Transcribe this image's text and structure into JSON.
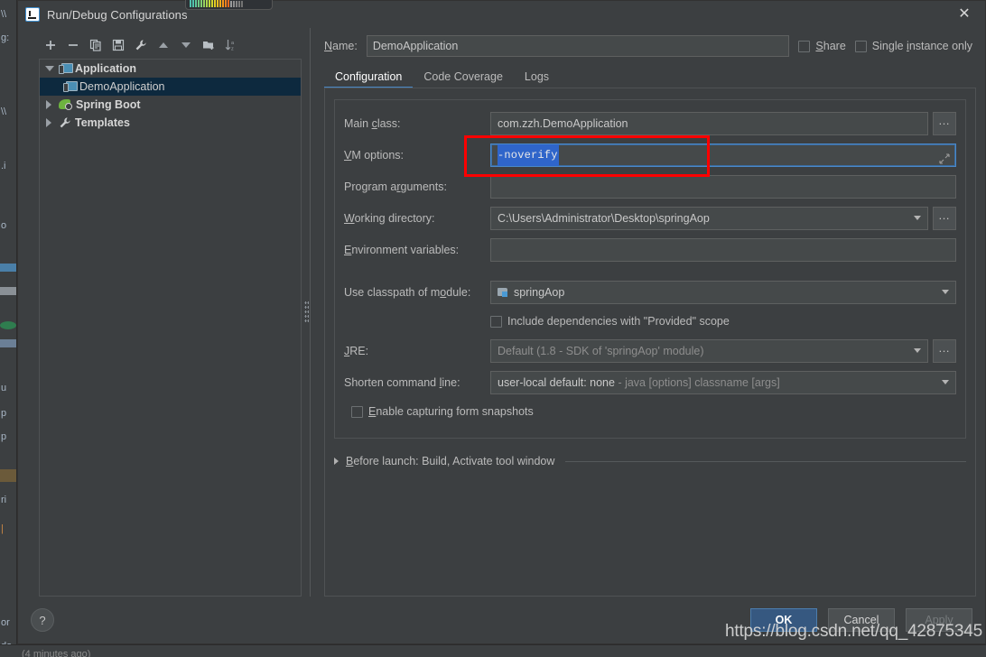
{
  "window": {
    "title": "Run/Debug Configurations",
    "logo_icon": "intellij-idea-logo",
    "close_icon": "close-icon"
  },
  "toolbar": {
    "buttons": [
      {
        "name": "add-configuration",
        "icon": "plus-icon",
        "label": "+"
      },
      {
        "name": "remove-configuration",
        "icon": "minus-icon",
        "label": "−"
      },
      {
        "name": "copy-configuration",
        "icon": "copy-icon",
        "label": ""
      },
      {
        "name": "save-configuration",
        "icon": "save-icon",
        "label": ""
      },
      {
        "name": "edit-defaults",
        "icon": "wrench-icon",
        "label": ""
      },
      {
        "name": "move-up",
        "icon": "arrow-up-icon",
        "label": ""
      },
      {
        "name": "move-down",
        "icon": "arrow-down-icon",
        "label": ""
      },
      {
        "name": "new-folder",
        "icon": "folder-add-icon",
        "label": ""
      },
      {
        "name": "sort-alphabetically",
        "icon": "sort-az-icon",
        "label": ""
      }
    ]
  },
  "tree": {
    "items": [
      {
        "label": "Application",
        "icon": "application-icon",
        "level": 0,
        "expanded": true,
        "selected": false
      },
      {
        "label": "DemoApplication",
        "icon": "application-icon",
        "level": 1,
        "expanded": null,
        "selected": true
      },
      {
        "label": "Spring Boot",
        "icon": "spring-boot-icon",
        "level": 0,
        "expanded": false,
        "selected": false
      },
      {
        "label": "Templates",
        "icon": "wrench-icon",
        "level": 0,
        "expanded": false,
        "selected": false
      }
    ]
  },
  "header": {
    "name_label": "Name:",
    "name_value": "DemoApplication",
    "share_label": "Share",
    "share_checked": false,
    "single_instance_label": "Single instance only",
    "single_instance_checked": false
  },
  "tabs": [
    {
      "label": "Configuration",
      "active": true
    },
    {
      "label": "Code Coverage",
      "active": false
    },
    {
      "label": "Logs",
      "active": false
    }
  ],
  "form": {
    "main_class": {
      "label": "Main class:",
      "value": "com.zzh.DemoApplication",
      "browse_label": "...",
      "browse_icon": "ellipsis-icon"
    },
    "vm_options": {
      "label": "VM options:",
      "value": "-noverify",
      "selected": true,
      "focused": true,
      "expand_icon": "expand-arrows-icon",
      "highlight_color": "#2f65ca",
      "annotation_color": "#ff0000"
    },
    "program_arguments": {
      "label": "Program arguments:",
      "value": "",
      "expand_icon": "expand-arrows-icon"
    },
    "working_directory": {
      "label": "Working directory:",
      "value": "C:\\Users\\Administrator\\Desktop\\springAop",
      "dropdown_icon": "chevron-down-icon",
      "browse_label": "...",
      "browse_icon": "ellipsis-icon"
    },
    "environment_variables": {
      "label": "Environment variables:",
      "value": "",
      "browse_icon": "folder-icon"
    },
    "use_classpath_of_module": {
      "label": "Use classpath of module:",
      "value": "springAop",
      "value_icon": "module-icon",
      "dropdown_icon": "chevron-down-icon"
    },
    "include_dependencies": {
      "label": "Include dependencies with \"Provided\" scope",
      "checked": false
    },
    "jre": {
      "label": "JRE:",
      "value": "Default",
      "value_hint": "(1.8 - SDK of 'springAop' module)",
      "dropdown_icon": "chevron-down-icon",
      "browse_label": "...",
      "browse_icon": "ellipsis-icon"
    },
    "shorten_command_line": {
      "label": "Shorten command line:",
      "value": "user-local default: none",
      "value_hint": "- java [options] classname [args]",
      "dropdown_icon": "chevron-down-icon"
    },
    "enable_capturing": {
      "label": "Enable capturing form snapshots",
      "checked": false
    }
  },
  "before_launch": {
    "label": "Before launch: Build, Activate tool window",
    "expand_icon": "triangle-right-icon",
    "expanded": false
  },
  "footer": {
    "help_label": "?",
    "help_icon": "help-icon",
    "ok_label": "OK",
    "cancel_label": "Cancel",
    "apply_label": "Apply",
    "apply_enabled": false
  },
  "watermark": {
    "text": "https://blog.csdn.net/qq_42875345"
  },
  "background": {
    "left_fragments": [
      "\\\\",
      "g:",
      "\\\\",
      ".i",
      "o",
      "u",
      "p",
      "p",
      "ri",
      "|",
      "or",
      "da"
    ],
    "bottom_fragment": "(4 minutes ago)"
  },
  "colors": {
    "dialog_bg": "#3c3f41",
    "field_bg": "#45494a",
    "accent": "#4a88c7",
    "selection": "#0d293e",
    "primary_button": "#365880",
    "annotation": "#ff0000"
  }
}
